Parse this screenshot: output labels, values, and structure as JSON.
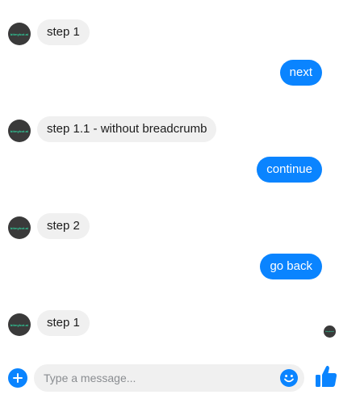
{
  "avatar": {
    "logo_text": "bitmybot.ai"
  },
  "messages": [
    {
      "sender": "bot",
      "text": "step 1"
    },
    {
      "sender": "user",
      "text": "next"
    },
    {
      "sender": "bot",
      "text": "step 1.1 - without breadcrumb"
    },
    {
      "sender": "user",
      "text": "continue"
    },
    {
      "sender": "bot",
      "text": "step 2"
    },
    {
      "sender": "user",
      "text": "go back"
    },
    {
      "sender": "bot",
      "text": "step 1"
    }
  ],
  "composer": {
    "placeholder": "Type a message...",
    "value": ""
  },
  "icons": {
    "add": "plus-icon",
    "emoji": "smiley-icon",
    "like": "thumbs-up-icon"
  },
  "colors": {
    "accent": "#0a84ff",
    "bot_bubble": "#f0f0f0",
    "avatar_bg": "#3a3a3a",
    "logo": "#2fd5a0"
  }
}
